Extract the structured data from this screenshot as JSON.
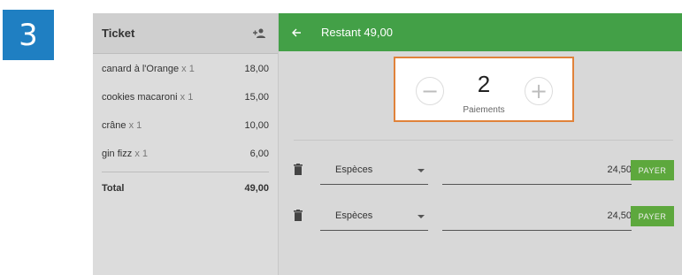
{
  "step_number": "3",
  "ticket": {
    "title": "Ticket",
    "items": [
      {
        "name": "canard à l'Orange",
        "qty": "x 1",
        "price": "18,00"
      },
      {
        "name": "cookies macaroni",
        "qty": "x 1",
        "price": "15,00"
      },
      {
        "name": "crâne",
        "qty": "x 1",
        "price": "10,00"
      },
      {
        "name": "gin fizz",
        "qty": "x 1",
        "price": "6,00"
      }
    ],
    "total_label": "Total",
    "total_value": "49,00"
  },
  "header": {
    "remaining": "Restant 49,00"
  },
  "payments": {
    "count": "2",
    "caption": "Paiements",
    "minus_symbol": "−",
    "plus_symbol": "+",
    "rows": [
      {
        "method": "Espèces",
        "amount": "24,50",
        "button": "PAYER"
      },
      {
        "method": "Espèces",
        "amount": "24,50",
        "button": "PAYER"
      }
    ]
  },
  "colors": {
    "header_green": "#43a047",
    "pay_button": "#5da83d",
    "highlight_border": "#e0823a",
    "step_badge": "#1f7fc2"
  },
  "icons": [
    "add-person-icon",
    "back-arrow-icon",
    "trash-icon",
    "caret-down-icon"
  ]
}
